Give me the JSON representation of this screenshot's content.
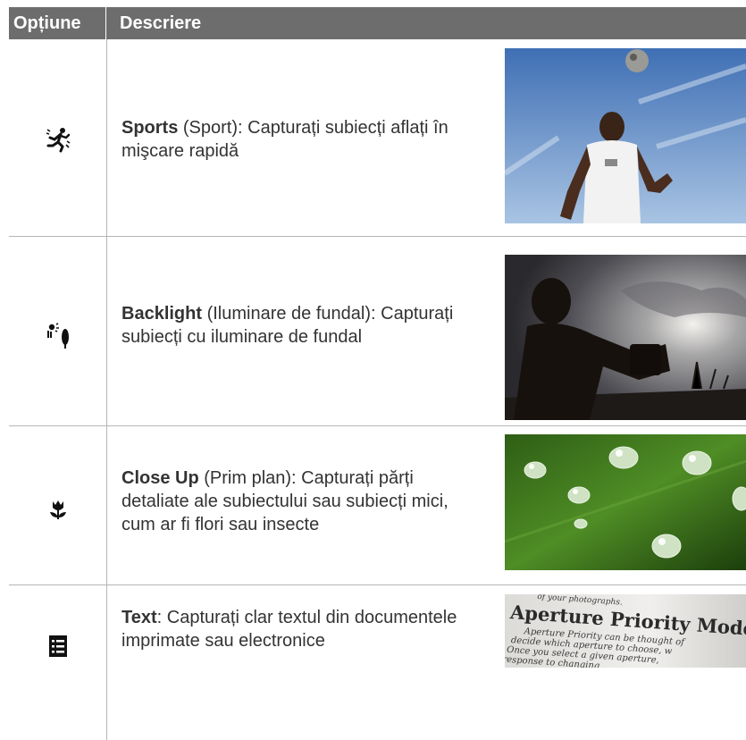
{
  "header": {
    "option": "Opțiune",
    "description": "Descriere"
  },
  "rows": [
    {
      "icon": "sports-running-icon",
      "name": "Sports",
      "desc": " (Sport): Capturați subiecți aflați în mişcare rapidă",
      "photo": "soccer-player-heading-ball-photo"
    },
    {
      "icon": "backlight-person-tree-icon",
      "name": "Backlight",
      "desc": " (Iluminare de fundal): Capturați subiecți cu iluminare de fundal",
      "photo": "silhouette-photographer-photo"
    },
    {
      "icon": "macro-tulip-icon",
      "name": "Close Up",
      "desc": " (Prim plan): Capturați părți detaliate ale subiectului sau subiecți mici, cum ar fi flori sau insecte",
      "photo": "water-drops-on-leaf-photo"
    },
    {
      "icon": "text-document-icon",
      "name": "Text",
      "desc": ": Capturați clar textul din documentele imprimate sau electronice",
      "photo": "book-page-photo"
    }
  ],
  "book_photo_text": {
    "line0": "of your photographs.",
    "title": "Aperture Priority Mode",
    "l1": "Aperture Priority can be thought of",
    "l2": "decide which aperture to choose, w",
    "l3": "Once you select a given aperture,",
    "l4": "response to changing"
  },
  "colors": {
    "header_bg": "#6d6d6d",
    "rule": "#b5b5b5",
    "text": "#333333"
  }
}
